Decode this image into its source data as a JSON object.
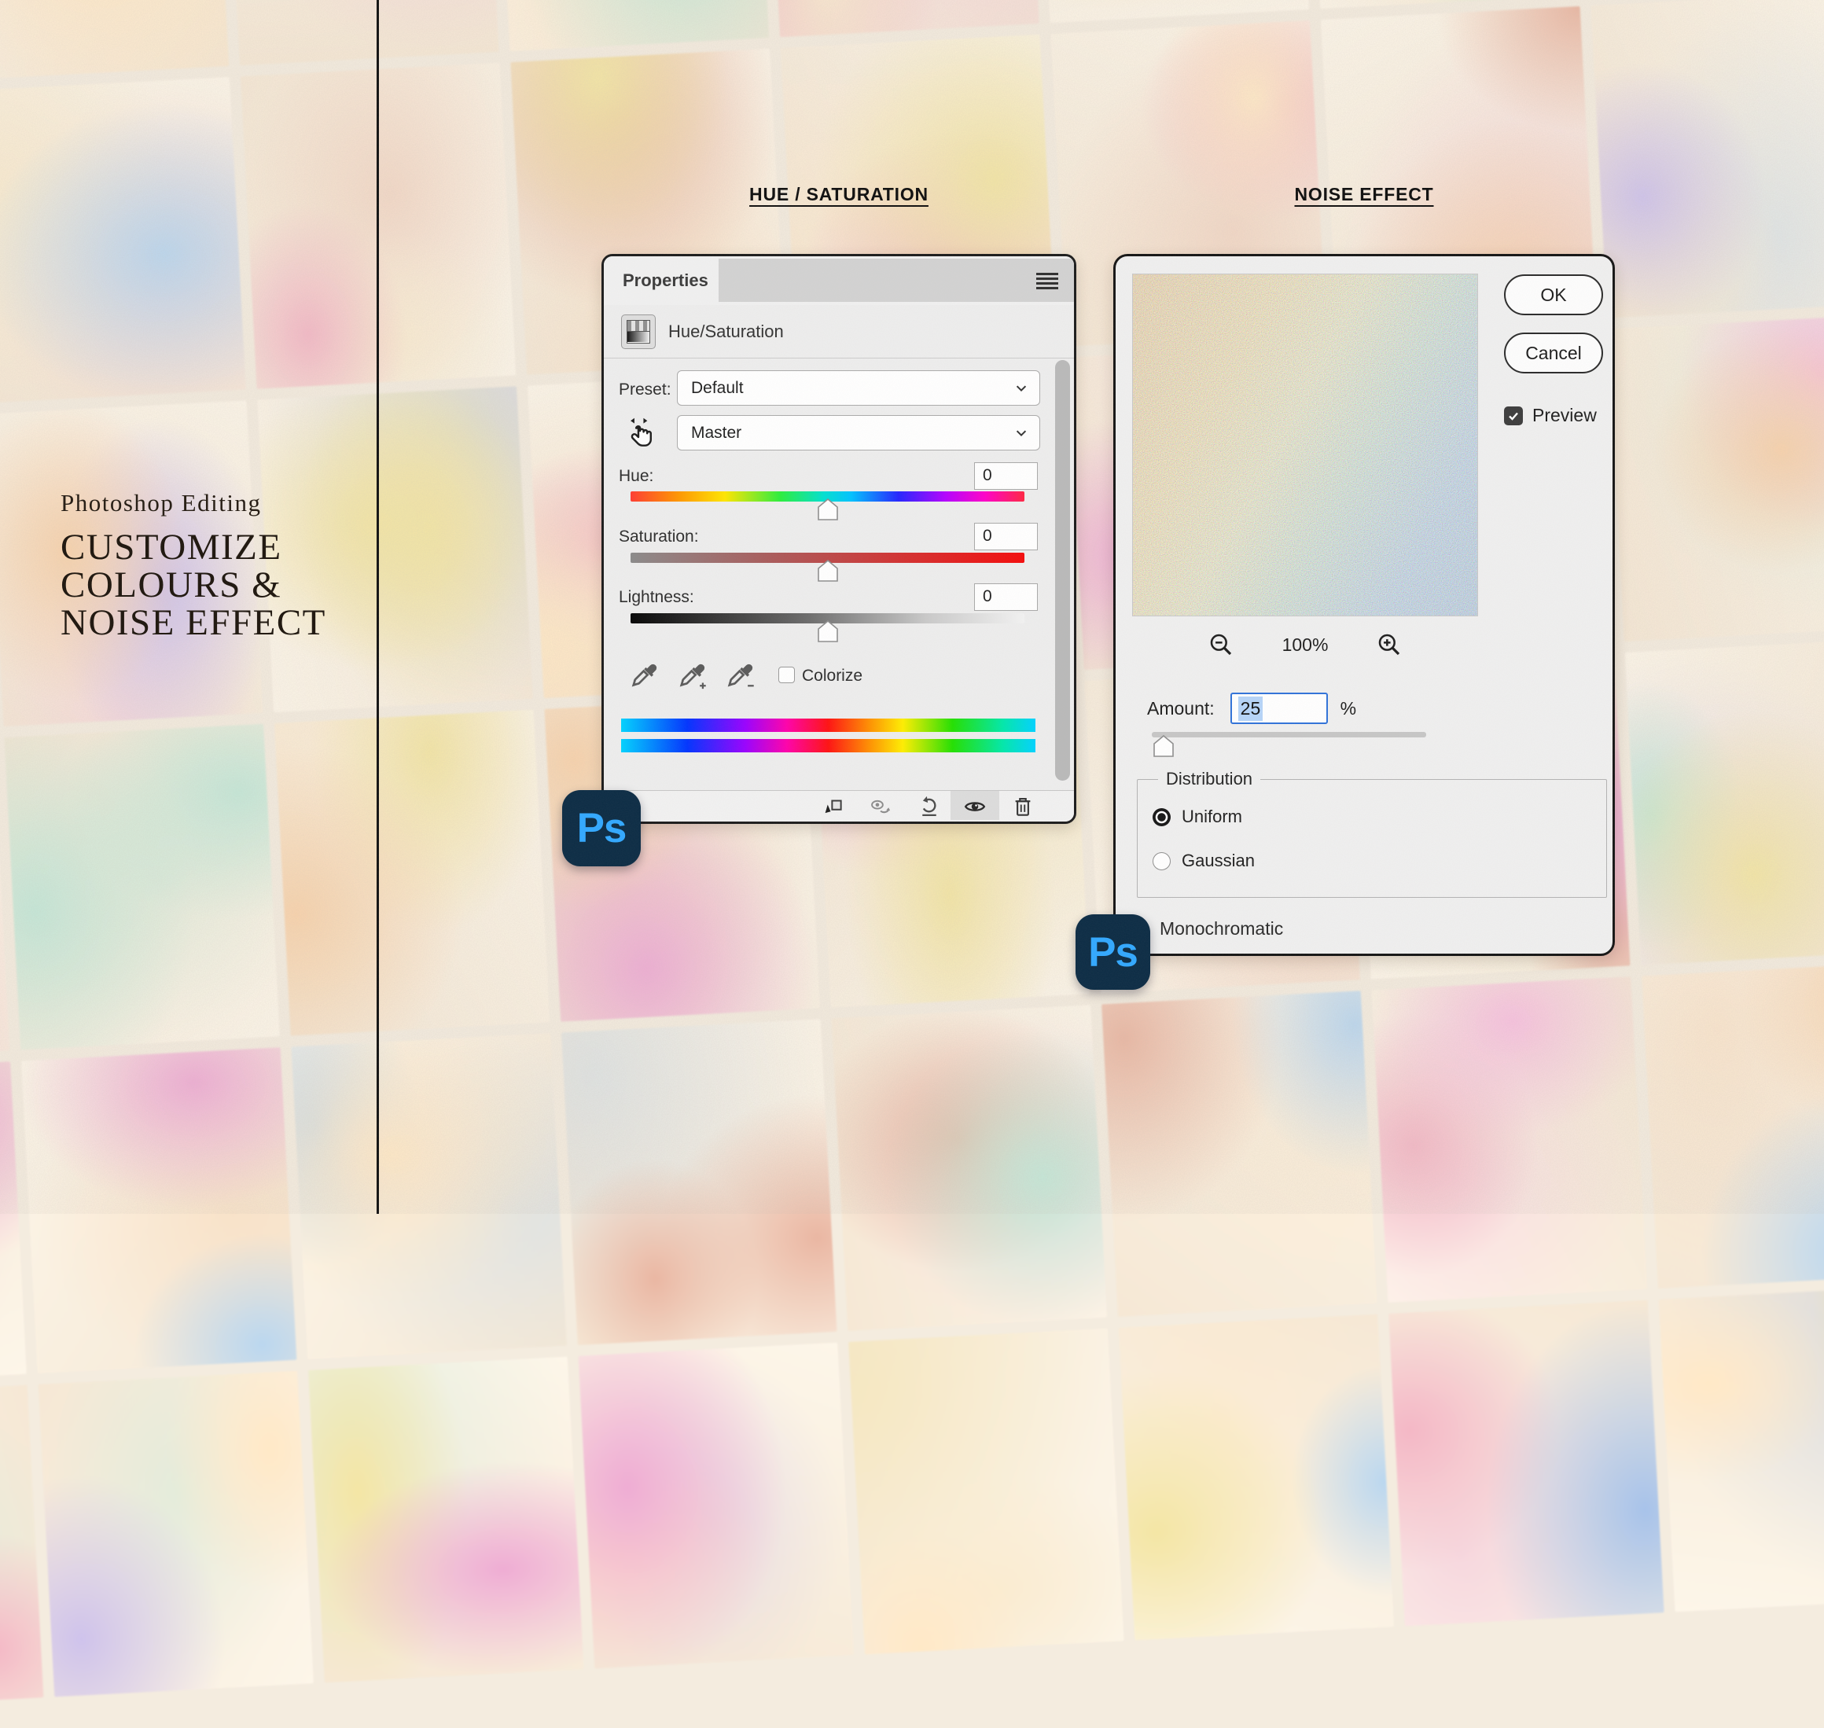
{
  "page": {
    "left_panel": {
      "subtitle": "Photoshop Editing",
      "title_lines": [
        "CUSTOMIZE",
        "COLOURS &",
        "NOISE EFFECT"
      ]
    },
    "section_headers": {
      "hue_saturation": "HUE / SATURATION",
      "noise_effect": "NOISE EFFECT"
    }
  },
  "properties_panel": {
    "tab_label": "Properties",
    "adjustment_title": "Hue/Saturation",
    "preset": {
      "label": "Preset:",
      "value": "Default"
    },
    "channel": {
      "value": "Master"
    },
    "sliders": [
      {
        "label": "Hue:",
        "value": "0"
      },
      {
        "label": "Saturation:",
        "value": "0"
      },
      {
        "label": "Lightness:",
        "value": "0"
      }
    ],
    "colorize_label": "Colorize",
    "icons": [
      "panel-menu-icon",
      "targeted-adjustment-icon",
      "chevron-down-icon",
      "eyedropper-icon",
      "eyedropper-plus-icon",
      "eyedropper-minus-icon",
      "clip-to-layer-icon",
      "toggle-previous-state-icon",
      "reset-icon",
      "visibility-icon",
      "delete-icon"
    ]
  },
  "noise_dialog": {
    "ok_label": "OK",
    "cancel_label": "Cancel",
    "preview_label": "Preview",
    "preview_checked": true,
    "zoom_level": "100%",
    "amount": {
      "label": "Amount:",
      "value": "25",
      "unit": "%"
    },
    "distribution": {
      "legend": "Distribution",
      "options": [
        {
          "label": "Uniform",
          "selected": true
        },
        {
          "label": "Gaussian",
          "selected": false
        }
      ]
    },
    "monochromatic_label": "Monochromatic",
    "icons": [
      "zoom-out-icon",
      "zoom-in-icon",
      "check-icon"
    ]
  },
  "branding": {
    "ps_badge_label": "Ps"
  },
  "colors": {
    "ps_badge_bg": "#0b2b44",
    "ps_badge_text": "#31a8ff",
    "focus_blue": "#2f72d9",
    "selection_blue": "#b6d4f8",
    "panel_bg": "#ededed",
    "dialog_bg": "#efefef",
    "background_palette": [
      "#f2b9c6",
      "#f7d3ae",
      "#f9ecd2",
      "#bcd7ee",
      "#cfc3ea",
      "#c5e8d8",
      "#edaed3",
      "#f3e6a8",
      "#e8b7a4",
      "#a9c3e8",
      "#f6c2de",
      "#ffe9c9"
    ]
  }
}
